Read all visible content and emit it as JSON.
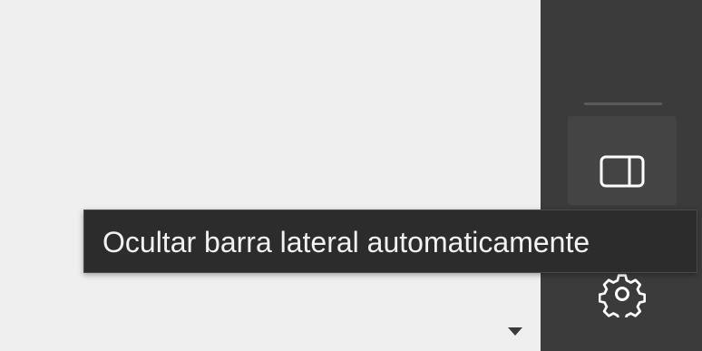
{
  "tooltip": {
    "text": "Ocultar barra lateral automaticamente"
  },
  "icons": {
    "sidebar_toggle": "sidebar-panel-icon",
    "settings": "gear-icon",
    "dropdown": "caret-down-icon"
  },
  "colors": {
    "sidebar_bg": "#3b3b3b",
    "button_bg": "#444444",
    "tooltip_bg": "#2c2c2c",
    "tooltip_text": "#f2f2f2",
    "content_bg": "#efefef"
  }
}
